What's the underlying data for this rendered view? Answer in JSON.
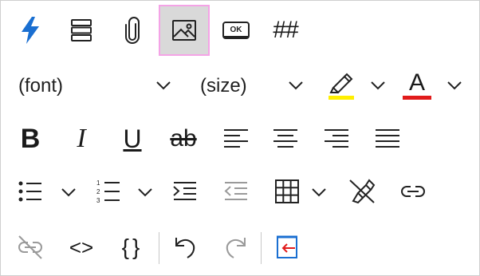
{
  "toolbar": {
    "font_label": "(font)",
    "size_label": "(size)",
    "hash_label": "##",
    "ok_label": "OK",
    "bold_label": "B",
    "italic_label": "I",
    "underline_label": "U",
    "strike_label": "ab",
    "font_color_label": "A",
    "code_label": "<>",
    "braces_label": "{}"
  },
  "colors": {
    "accent_blue": "#1a6fd1",
    "highlight": "#ffef00",
    "font_color": "#e11b1b",
    "disabled": "#9a9a9a",
    "selected_border": "#f4a3e6"
  }
}
